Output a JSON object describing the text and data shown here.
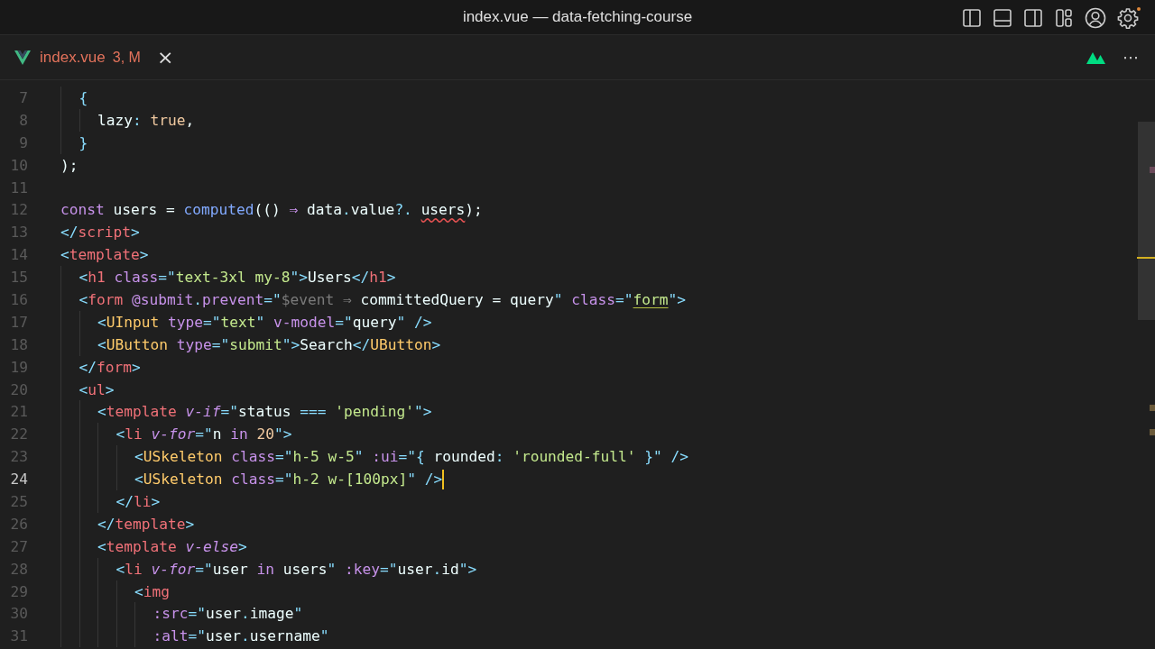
{
  "window": {
    "title": "index.vue — data-fetching-course"
  },
  "tabs": [
    {
      "label": "index.vue",
      "badge": "3, M",
      "selected": true,
      "close": "×"
    }
  ],
  "editor_actions": {
    "more": "⋯"
  },
  "code": [
    {
      "children": [
        {
          "number": "7",
          "current": false,
          "tokens": [
            {
              "text": "{",
              "kind": "punct"
            }
          ],
          "children": [
            {
              "number": "8",
              "current": false,
              "tokens": [
                {
                  "text": "lazy",
                  "kind": "plain"
                },
                {
                  "text": ": ",
                  "kind": "punct"
                },
                {
                  "text": "true",
                  "kind": "number"
                },
                {
                  "text": ",",
                  "kind": "plain"
                }
              ]
            }
          ]
        },
        {
          "number": "9",
          "current": false,
          "tokens": [
            {
              "text": "}",
              "kind": "punct"
            }
          ]
        }
      ]
    },
    {
      "number": "10",
      "current": false,
      "tokens": [
        {
          "text": ");",
          "kind": "plain"
        }
      ]
    },
    {
      "number": "11",
      "current": false
    },
    {
      "number": "12",
      "current": false,
      "tokens": [
        {
          "text": "const",
          "kind": "keyword"
        },
        {
          "text": " users = ",
          "kind": "plain"
        },
        {
          "text": "computed",
          "kind": "function"
        },
        {
          "text": "(() ",
          "kind": "plain"
        },
        {
          "text": "⇒",
          "kind": "keyword"
        },
        {
          "text": " data",
          "kind": "plain"
        },
        {
          "text": ".",
          "kind": "punct"
        },
        {
          "text": "value",
          "kind": "plain"
        },
        {
          "text": "?. ",
          "kind": "punct"
        },
        {
          "text": "users",
          "kind": "plain",
          "error": true
        },
        {
          "text": ");",
          "kind": "plain"
        }
      ]
    },
    {
      "number": "13",
      "current": false,
      "tokens": [
        {
          "text": "</",
          "kind": "punct"
        },
        {
          "text": "script",
          "kind": "tag"
        },
        {
          "text": ">",
          "kind": "punct"
        }
      ]
    },
    {
      "number": "14",
      "current": false,
      "tokens": [
        {
          "text": "<",
          "kind": "punct"
        },
        {
          "text": "template",
          "kind": "tag"
        },
        {
          "text": ">",
          "kind": "punct"
        }
      ],
      "children": [
        {
          "number": "15",
          "current": false,
          "tokens": [
            {
              "text": "<",
              "kind": "punct"
            },
            {
              "text": "h1",
              "kind": "tag"
            },
            {
              "text": " class",
              "kind": "attr"
            },
            {
              "text": "=\"",
              "kind": "punct"
            },
            {
              "text": "text-3xl my-8",
              "kind": "string"
            },
            {
              "text": "\">",
              "kind": "punct"
            },
            {
              "text": "Users",
              "kind": "plain"
            },
            {
              "text": "</",
              "kind": "punct"
            },
            {
              "text": "h1",
              "kind": "tag"
            },
            {
              "text": ">",
              "kind": "punct"
            }
          ]
        },
        {
          "number": "16",
          "current": false,
          "tokens": [
            {
              "text": "<",
              "kind": "punct"
            },
            {
              "text": "form",
              "kind": "tag"
            },
            {
              "text": " @submit",
              "kind": "attr"
            },
            {
              "text": ".",
              "kind": "punct"
            },
            {
              "text": "prevent",
              "kind": "attr"
            },
            {
              "text": "=\"",
              "kind": "punct"
            },
            {
              "text": "$event",
              "kind": "muted"
            },
            {
              "text": " ⇒ ",
              "kind": "muted"
            },
            {
              "text": "committedQuery = query",
              "kind": "plain"
            },
            {
              "text": "\"",
              "kind": "punct"
            },
            {
              "text": " class",
              "kind": "attr"
            },
            {
              "text": "=\"",
              "kind": "punct"
            },
            {
              "text": "form",
              "kind": "string",
              "warning": true
            },
            {
              "text": "\">",
              "kind": "punct"
            }
          ],
          "children": [
            {
              "number": "17",
              "current": false,
              "tokens": [
                {
                  "text": "<",
                  "kind": "punct"
                },
                {
                  "text": "UInput",
                  "kind": "component"
                },
                {
                  "text": " type",
                  "kind": "attr"
                },
                {
                  "text": "=\"",
                  "kind": "punct"
                },
                {
                  "text": "text",
                  "kind": "string"
                },
                {
                  "text": "\"",
                  "kind": "punct"
                },
                {
                  "text": " v-model",
                  "kind": "attr"
                },
                {
                  "text": "=\"",
                  "kind": "punct"
                },
                {
                  "text": "query",
                  "kind": "plain"
                },
                {
                  "text": "\" />",
                  "kind": "punct"
                }
              ]
            },
            {
              "number": "18",
              "current": false,
              "tokens": [
                {
                  "text": "<",
                  "kind": "punct"
                },
                {
                  "text": "UButton",
                  "kind": "component"
                },
                {
                  "text": " type",
                  "kind": "attr"
                },
                {
                  "text": "=\"",
                  "kind": "punct"
                },
                {
                  "text": "submit",
                  "kind": "string"
                },
                {
                  "text": "\">",
                  "kind": "punct"
                },
                {
                  "text": "Search",
                  "kind": "plain"
                },
                {
                  "text": "</",
                  "kind": "punct"
                },
                {
                  "text": "UButton",
                  "kind": "component"
                },
                {
                  "text": ">",
                  "kind": "punct"
                }
              ]
            }
          ]
        },
        {
          "number": "19",
          "current": false,
          "tokens": [
            {
              "text": "</",
              "kind": "punct"
            },
            {
              "text": "form",
              "kind": "tag"
            },
            {
              "text": ">",
              "kind": "punct"
            }
          ]
        },
        {
          "number": "20",
          "current": false,
          "tokens": [
            {
              "text": "<",
              "kind": "punct"
            },
            {
              "text": "ul",
              "kind": "tag"
            },
            {
              "text": ">",
              "kind": "punct"
            }
          ],
          "children": [
            {
              "number": "21",
              "current": false,
              "tokens": [
                {
                  "text": "<",
                  "kind": "punct"
                },
                {
                  "text": "template",
                  "kind": "tag"
                },
                {
                  "text": " v-if",
                  "kind": "directive"
                },
                {
                  "text": "=\"",
                  "kind": "punct"
                },
                {
                  "text": "status ",
                  "kind": "plain"
                },
                {
                  "text": "===",
                  "kind": "punct"
                },
                {
                  "text": " 'pending'",
                  "kind": "string"
                },
                {
                  "text": "\">",
                  "kind": "punct"
                }
              ],
              "children": [
                {
                  "number": "22",
                  "current": false,
                  "tokens": [
                    {
                      "text": "<",
                      "kind": "punct"
                    },
                    {
                      "text": "li",
                      "kind": "tag"
                    },
                    {
                      "text": " v-for",
                      "kind": "directive"
                    },
                    {
                      "text": "=\"",
                      "kind": "punct"
                    },
                    {
                      "text": "n ",
                      "kind": "plain"
                    },
                    {
                      "text": "in",
                      "kind": "keyword"
                    },
                    {
                      "text": " 20",
                      "kind": "number"
                    },
                    {
                      "text": "\">",
                      "kind": "punct"
                    }
                  ],
                  "children": [
                    {
                      "number": "23",
                      "current": false,
                      "tokens": [
                        {
                          "text": "<",
                          "kind": "punct"
                        },
                        {
                          "text": "USkeleton",
                          "kind": "component"
                        },
                        {
                          "text": " class",
                          "kind": "attr"
                        },
                        {
                          "text": "=\"",
                          "kind": "punct"
                        },
                        {
                          "text": "h-5 w-5",
                          "kind": "string"
                        },
                        {
                          "text": "\"",
                          "kind": "punct"
                        },
                        {
                          "text": " :ui",
                          "kind": "attr"
                        },
                        {
                          "text": "=\"{ ",
                          "kind": "punct"
                        },
                        {
                          "text": "rounded",
                          "kind": "plain"
                        },
                        {
                          "text": ": ",
                          "kind": "punct"
                        },
                        {
                          "text": "'rounded-full'",
                          "kind": "string"
                        },
                        {
                          "text": " }\" />",
                          "kind": "punct"
                        }
                      ]
                    },
                    {
                      "number": "24",
                      "current": true,
                      "tokens": [
                        {
                          "text": "<",
                          "kind": "punct"
                        },
                        {
                          "text": "USkeleton",
                          "kind": "component"
                        },
                        {
                          "text": " class",
                          "kind": "attr"
                        },
                        {
                          "text": "=\"",
                          "kind": "punct"
                        },
                        {
                          "text": "h-2 w-[100px]",
                          "kind": "string"
                        },
                        {
                          "text": "\" />",
                          "kind": "punct"
                        }
                      ]
                    }
                  ]
                },
                {
                  "number": "25",
                  "current": false,
                  "tokens": [
                    {
                      "text": "</",
                      "kind": "punct"
                    },
                    {
                      "text": "li",
                      "kind": "tag"
                    },
                    {
                      "text": ">",
                      "kind": "punct"
                    }
                  ]
                }
              ]
            },
            {
              "number": "26",
              "current": false,
              "tokens": [
                {
                  "text": "</",
                  "kind": "punct"
                },
                {
                  "text": "template",
                  "kind": "tag"
                },
                {
                  "text": ">",
                  "kind": "punct"
                }
              ]
            },
            {
              "number": "27",
              "current": false,
              "tokens": [
                {
                  "text": "<",
                  "kind": "punct"
                },
                {
                  "text": "template",
                  "kind": "tag"
                },
                {
                  "text": " v-else",
                  "kind": "directive"
                },
                {
                  "text": ">",
                  "kind": "punct"
                }
              ],
              "children": [
                {
                  "number": "28",
                  "current": false,
                  "tokens": [
                    {
                      "text": "<",
                      "kind": "punct"
                    },
                    {
                      "text": "li",
                      "kind": "tag"
                    },
                    {
                      "text": " v-for",
                      "kind": "directive"
                    },
                    {
                      "text": "=\"",
                      "kind": "punct"
                    },
                    {
                      "text": "user ",
                      "kind": "plain"
                    },
                    {
                      "text": "in",
                      "kind": "keyword"
                    },
                    {
                      "text": " users",
                      "kind": "plain"
                    },
                    {
                      "text": "\"",
                      "kind": "punct"
                    },
                    {
                      "text": " :key",
                      "kind": "attr"
                    },
                    {
                      "text": "=\"",
                      "kind": "punct"
                    },
                    {
                      "text": "user",
                      "kind": "plain"
                    },
                    {
                      "text": ".",
                      "kind": "punct"
                    },
                    {
                      "text": "id",
                      "kind": "plain"
                    },
                    {
                      "text": "\">",
                      "kind": "punct"
                    }
                  ],
                  "children": [
                    {
                      "number": "29",
                      "current": false,
                      "tokens": [
                        {
                          "text": "<",
                          "kind": "punct"
                        },
                        {
                          "text": "img",
                          "kind": "tag"
                        }
                      ],
                      "children": [
                        {
                          "number": "30",
                          "current": false,
                          "tokens": [
                            {
                              "text": ":src",
                              "kind": "attr"
                            },
                            {
                              "text": "=\"",
                              "kind": "punct"
                            },
                            {
                              "text": "user",
                              "kind": "plain"
                            },
                            {
                              "text": ".",
                              "kind": "punct"
                            },
                            {
                              "text": "image",
                              "kind": "plain"
                            },
                            {
                              "text": "\"",
                              "kind": "punct"
                            }
                          ]
                        },
                        {
                          "number": "31",
                          "current": false,
                          "tokens": [
                            {
                              "text": ":alt",
                              "kind": "attr"
                            },
                            {
                              "text": "=\"",
                              "kind": "punct"
                            },
                            {
                              "text": "user",
                              "kind": "plain"
                            },
                            {
                              "text": ".",
                              "kind": "punct"
                            },
                            {
                              "text": "username",
                              "kind": "plain"
                            },
                            {
                              "text": "\"",
                              "kind": "punct"
                            }
                          ]
                        }
                      ]
                    }
                  ]
                }
              ]
            }
          ]
        }
      ]
    }
  ]
}
